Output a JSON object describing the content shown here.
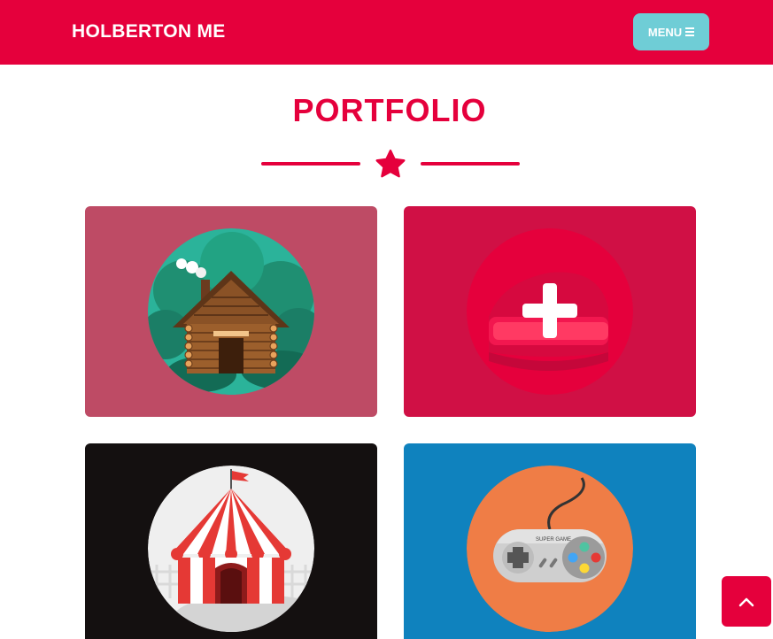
{
  "colors": {
    "brand": "#e5003c",
    "menu_button": "#6fcdd6",
    "card1_bg": "#be4b65",
    "card2_bg": "#d01045",
    "card3_bg": "#141010",
    "card4_bg": "#0f82be"
  },
  "navbar": {
    "brand": "HOLBERTON ME",
    "menu_label": "MENU",
    "menu_icon": "bars-icon"
  },
  "portfolio": {
    "title": "PORTFOLIO",
    "divider_icon": "star-icon",
    "items": [
      {
        "icon": "cabin-icon"
      },
      {
        "icon": "cake-icon"
      },
      {
        "icon": "circus-tent-icon"
      },
      {
        "icon": "game-controller-icon"
      }
    ],
    "controller_text": "SUPER GAME"
  },
  "scroll_top": {
    "icon": "chevron-up-icon"
  }
}
